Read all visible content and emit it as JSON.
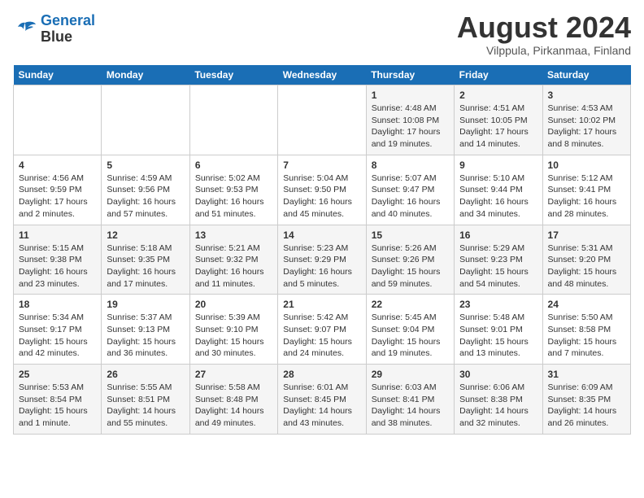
{
  "header": {
    "logo_line1": "General",
    "logo_line2": "Blue",
    "title": "August 2024",
    "subtitle": "Vilppula, Pirkanmaa, Finland"
  },
  "weekdays": [
    "Sunday",
    "Monday",
    "Tuesday",
    "Wednesday",
    "Thursday",
    "Friday",
    "Saturday"
  ],
  "weeks": [
    [
      {
        "day": "",
        "info": ""
      },
      {
        "day": "",
        "info": ""
      },
      {
        "day": "",
        "info": ""
      },
      {
        "day": "",
        "info": ""
      },
      {
        "day": "1",
        "info": "Sunrise: 4:48 AM\nSunset: 10:08 PM\nDaylight: 17 hours\nand 19 minutes."
      },
      {
        "day": "2",
        "info": "Sunrise: 4:51 AM\nSunset: 10:05 PM\nDaylight: 17 hours\nand 14 minutes."
      },
      {
        "day": "3",
        "info": "Sunrise: 4:53 AM\nSunset: 10:02 PM\nDaylight: 17 hours\nand 8 minutes."
      }
    ],
    [
      {
        "day": "4",
        "info": "Sunrise: 4:56 AM\nSunset: 9:59 PM\nDaylight: 17 hours\nand 2 minutes."
      },
      {
        "day": "5",
        "info": "Sunrise: 4:59 AM\nSunset: 9:56 PM\nDaylight: 16 hours\nand 57 minutes."
      },
      {
        "day": "6",
        "info": "Sunrise: 5:02 AM\nSunset: 9:53 PM\nDaylight: 16 hours\nand 51 minutes."
      },
      {
        "day": "7",
        "info": "Sunrise: 5:04 AM\nSunset: 9:50 PM\nDaylight: 16 hours\nand 45 minutes."
      },
      {
        "day": "8",
        "info": "Sunrise: 5:07 AM\nSunset: 9:47 PM\nDaylight: 16 hours\nand 40 minutes."
      },
      {
        "day": "9",
        "info": "Sunrise: 5:10 AM\nSunset: 9:44 PM\nDaylight: 16 hours\nand 34 minutes."
      },
      {
        "day": "10",
        "info": "Sunrise: 5:12 AM\nSunset: 9:41 PM\nDaylight: 16 hours\nand 28 minutes."
      }
    ],
    [
      {
        "day": "11",
        "info": "Sunrise: 5:15 AM\nSunset: 9:38 PM\nDaylight: 16 hours\nand 23 minutes."
      },
      {
        "day": "12",
        "info": "Sunrise: 5:18 AM\nSunset: 9:35 PM\nDaylight: 16 hours\nand 17 minutes."
      },
      {
        "day": "13",
        "info": "Sunrise: 5:21 AM\nSunset: 9:32 PM\nDaylight: 16 hours\nand 11 minutes."
      },
      {
        "day": "14",
        "info": "Sunrise: 5:23 AM\nSunset: 9:29 PM\nDaylight: 16 hours\nand 5 minutes."
      },
      {
        "day": "15",
        "info": "Sunrise: 5:26 AM\nSunset: 9:26 PM\nDaylight: 15 hours\nand 59 minutes."
      },
      {
        "day": "16",
        "info": "Sunrise: 5:29 AM\nSunset: 9:23 PM\nDaylight: 15 hours\nand 54 minutes."
      },
      {
        "day": "17",
        "info": "Sunrise: 5:31 AM\nSunset: 9:20 PM\nDaylight: 15 hours\nand 48 minutes."
      }
    ],
    [
      {
        "day": "18",
        "info": "Sunrise: 5:34 AM\nSunset: 9:17 PM\nDaylight: 15 hours\nand 42 minutes."
      },
      {
        "day": "19",
        "info": "Sunrise: 5:37 AM\nSunset: 9:13 PM\nDaylight: 15 hours\nand 36 minutes."
      },
      {
        "day": "20",
        "info": "Sunrise: 5:39 AM\nSunset: 9:10 PM\nDaylight: 15 hours\nand 30 minutes."
      },
      {
        "day": "21",
        "info": "Sunrise: 5:42 AM\nSunset: 9:07 PM\nDaylight: 15 hours\nand 24 minutes."
      },
      {
        "day": "22",
        "info": "Sunrise: 5:45 AM\nSunset: 9:04 PM\nDaylight: 15 hours\nand 19 minutes."
      },
      {
        "day": "23",
        "info": "Sunrise: 5:48 AM\nSunset: 9:01 PM\nDaylight: 15 hours\nand 13 minutes."
      },
      {
        "day": "24",
        "info": "Sunrise: 5:50 AM\nSunset: 8:58 PM\nDaylight: 15 hours\nand 7 minutes."
      }
    ],
    [
      {
        "day": "25",
        "info": "Sunrise: 5:53 AM\nSunset: 8:54 PM\nDaylight: 15 hours\nand 1 minute."
      },
      {
        "day": "26",
        "info": "Sunrise: 5:55 AM\nSunset: 8:51 PM\nDaylight: 14 hours\nand 55 minutes."
      },
      {
        "day": "27",
        "info": "Sunrise: 5:58 AM\nSunset: 8:48 PM\nDaylight: 14 hours\nand 49 minutes."
      },
      {
        "day": "28",
        "info": "Sunrise: 6:01 AM\nSunset: 8:45 PM\nDaylight: 14 hours\nand 43 minutes."
      },
      {
        "day": "29",
        "info": "Sunrise: 6:03 AM\nSunset: 8:41 PM\nDaylight: 14 hours\nand 38 minutes."
      },
      {
        "day": "30",
        "info": "Sunrise: 6:06 AM\nSunset: 8:38 PM\nDaylight: 14 hours\nand 32 minutes."
      },
      {
        "day": "31",
        "info": "Sunrise: 6:09 AM\nSunset: 8:35 PM\nDaylight: 14 hours\nand 26 minutes."
      }
    ]
  ]
}
